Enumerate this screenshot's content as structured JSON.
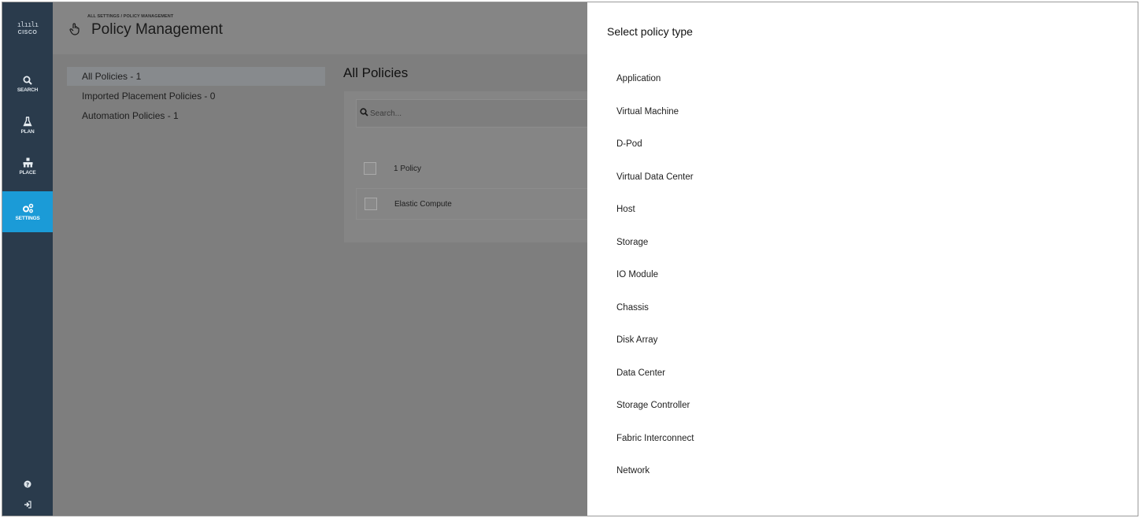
{
  "brand": {
    "logo_bars": "ılıılı",
    "logo_word": "CISCO"
  },
  "leftnav": {
    "items": [
      {
        "id": "search",
        "label": "SEARCH",
        "icon": "search-icon",
        "active": false
      },
      {
        "id": "plan",
        "label": "PLAN",
        "icon": "flask-icon",
        "active": false
      },
      {
        "id": "place",
        "label": "PLACE",
        "icon": "place-icon",
        "active": false
      },
      {
        "id": "settings",
        "label": "SETTINGS",
        "icon": "gears-icon",
        "active": true
      }
    ],
    "bottom_icons": [
      "help-icon",
      "logout-icon"
    ]
  },
  "header": {
    "breadcrumb": "ALL SETTINGS / POLICY MANAGEMENT",
    "title": "Policy Management",
    "icon": "hand-pointer-icon"
  },
  "subnav": {
    "items": [
      {
        "label": "All Policies - 1",
        "active": true
      },
      {
        "label": "Imported Placement Policies - 0",
        "active": false
      },
      {
        "label": "Automation Policies - 1",
        "active": false
      }
    ]
  },
  "content": {
    "title": "All Policies",
    "search_placeholder": "Search...",
    "header_row_label": "1 Policy",
    "rows": [
      "Elastic Compute"
    ]
  },
  "panel": {
    "title": "Select policy type",
    "options": [
      "Application",
      "Virtual Machine",
      "D-Pod",
      "Virtual Data Center",
      "Host",
      "Storage",
      "IO Module",
      "Chassis",
      "Disk Array",
      "Data Center",
      "Storage Controller",
      "Fabric Interconnect",
      "Network"
    ]
  },
  "colors": {
    "nav_bg": "#2a3b4c",
    "nav_active": "#1b9bd7",
    "overlay": "#7e7e7e",
    "panel_bg": "#ffffff"
  }
}
